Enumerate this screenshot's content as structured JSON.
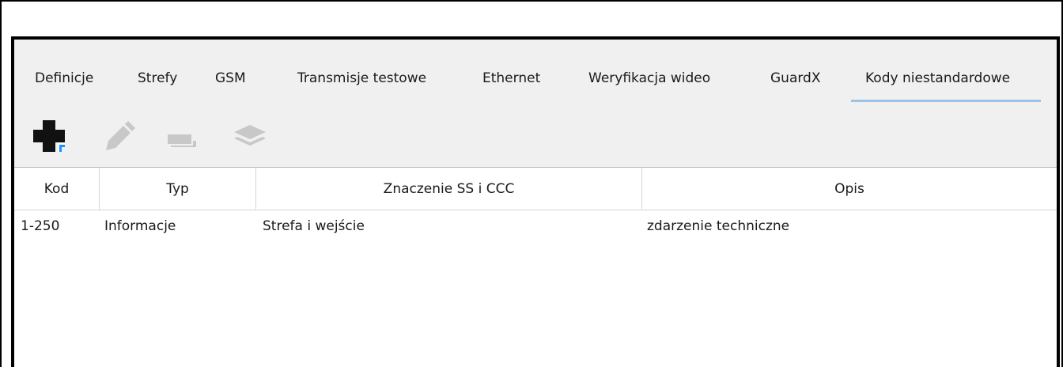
{
  "tabs": [
    {
      "label": "Definicje"
    },
    {
      "label": "Strefy"
    },
    {
      "label": "GSM"
    },
    {
      "label": "Transmisje testowe"
    },
    {
      "label": "Ethernet"
    },
    {
      "label": "Weryfikacja wideo"
    },
    {
      "label": "GuardX"
    },
    {
      "label": "Kody niestandardowe",
      "active": true
    }
  ],
  "toolbar": {
    "buttons": [
      {
        "icon": "add-icon",
        "enabled": true
      },
      {
        "icon": "edit-pencil-icon",
        "enabled": false
      },
      {
        "icon": "remove-icon",
        "enabled": false
      },
      {
        "icon": "layers-icon",
        "enabled": false
      }
    ]
  },
  "table": {
    "columns": [
      "Kod",
      "Typ",
      "Znaczenie SS i CCC",
      "Opis"
    ],
    "rows": [
      [
        "1-250",
        "Informacje",
        "Strefa i wejście",
        "zdarzenie techniczne"
      ]
    ]
  },
  "colors": {
    "active_tab_underline": "#9cc3e5",
    "add_icon_accent": "#1e90ff",
    "disabled_icon": "#c8c8c8"
  }
}
